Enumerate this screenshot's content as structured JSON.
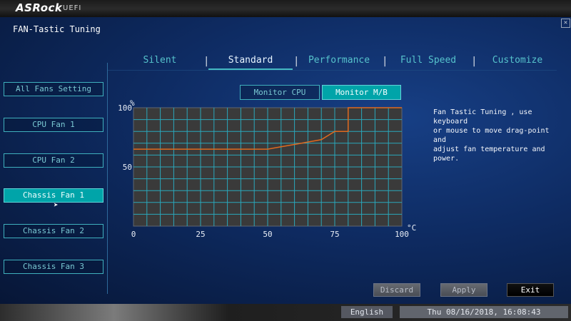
{
  "brand": {
    "logo": "ASRock",
    "logo_sub": "UEFI"
  },
  "page": {
    "title": "FAN-Tastic Tuning",
    "close_icon": "close-icon"
  },
  "tabs": [
    "Silent",
    "Standard",
    "Performance",
    "Full Speed",
    "Customize"
  ],
  "active_tab": "Standard",
  "fans": [
    "All Fans Setting",
    "CPU Fan 1",
    "CPU Fan 2",
    "Chassis Fan 1",
    "Chassis Fan 2",
    "Chassis Fan 3"
  ],
  "selected_fan": "Chassis Fan 1",
  "monitor": {
    "cpu": "Monitor CPU",
    "mb": "Monitor M/B",
    "selected": "Monitor M/B"
  },
  "description": "Fan Tastic Tuning , use keyboard\nor mouse to move drag-point and\nadjust fan temperature and power.",
  "actions": {
    "discard": "Discard",
    "apply": "Apply",
    "exit": "Exit"
  },
  "footer": {
    "language": "English",
    "datetime": "Thu 08/16/2018, 16:08:43"
  },
  "colors": {
    "accent": "#00a4a9",
    "tab_text": "#56c3cc",
    "curve": "#e06a1f",
    "grid": "#2aa7bb",
    "plot_bg": "#3a3a3a"
  },
  "chart_data": {
    "type": "line",
    "xlabel": "°C",
    "ylabel": "%",
    "xlim": [
      0,
      100
    ],
    "ylim": [
      0,
      100
    ],
    "x_ticks": [
      0,
      25,
      50,
      75,
      100
    ],
    "y_ticks": [
      50,
      100
    ],
    "series": [
      {
        "points": [
          [
            0,
            65
          ],
          [
            50,
            65
          ],
          [
            55,
            67
          ],
          [
            60,
            69
          ],
          [
            65,
            71
          ],
          [
            70,
            73
          ],
          [
            75,
            80
          ],
          [
            80,
            80
          ],
          [
            80,
            100
          ],
          [
            100,
            100
          ]
        ]
      }
    ]
  }
}
